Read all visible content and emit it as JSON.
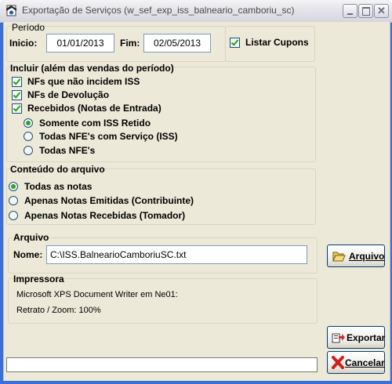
{
  "window": {
    "title": "Exportação de Serviços (w_sef_exp_iss_balneario_camboriu_sc)"
  },
  "periodo": {
    "legend": "Período",
    "inicio_label": "Inicio:",
    "inicio_value": "01/01/2013",
    "fim_label": "Fim:",
    "fim_value": "02/05/2013",
    "listar_cupons_label": "Listar Cupons",
    "listar_cupons_checked": true
  },
  "incluir": {
    "legend": "Incluir (além das vendas do período)",
    "nf_nao_incidem_iss": "NFs que não incidem ISS",
    "nf_devolucao": "NFs de Devolução",
    "recebidos": "Recebidos (Notas de Entrada)",
    "options": [
      "Somente com ISS Retido",
      "Todas NFE's com Serviço (ISS)",
      "Todas NFE's"
    ],
    "selected_option": 0
  },
  "conteudo": {
    "legend": "Conteúdo do arquivo",
    "options": [
      "Todas as notas",
      "Apenas Notas Emitidas (Contribuinte)",
      "Apenas Notas Recebidas (Tomador)"
    ],
    "selected_option": 0
  },
  "arquivo": {
    "legend": "Arquivo",
    "nome_label": "Nome:",
    "nome_value": "C:\\ISS.BalnearioCamboriuSC.txt",
    "button_label": "Arquivo"
  },
  "impressora": {
    "legend": "Impressora",
    "printer": "Microsoft XPS Document Writer em Ne01:",
    "layout": "Retrato / Zoom: 100%"
  },
  "actions": {
    "exportar_label": "Exportar",
    "cancelar_label": "Cancelar"
  },
  "status": {
    "text": ""
  },
  "colors": {
    "dialog_bg": "#ece9d8",
    "cancel_x": "#cc2020",
    "check_green": "#21a121"
  },
  "icons": [
    "app-icon",
    "minimize-icon",
    "maximize-icon",
    "close-icon",
    "folder-open-icon",
    "export-icon",
    "cancel-x-icon"
  ]
}
